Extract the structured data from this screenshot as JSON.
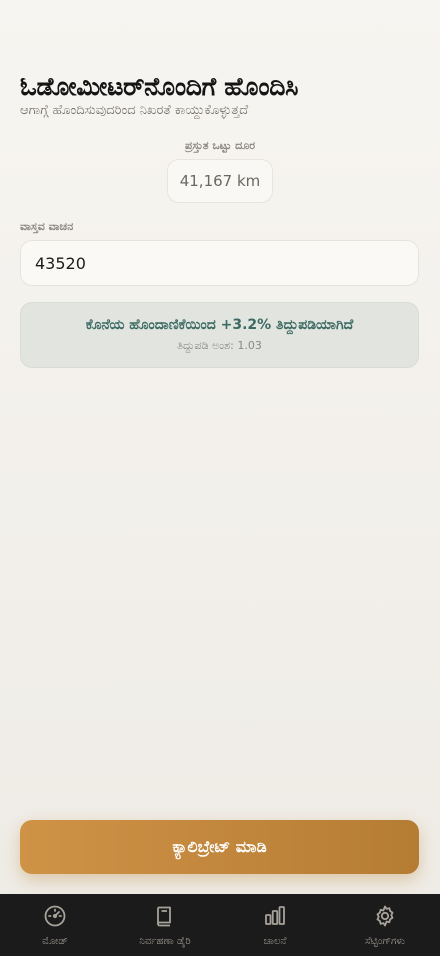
{
  "header": {
    "title": "ಓಡೋಮೀಟರ್‌ನೊಂದಿಗೆ ಹೊಂದಿಸಿ",
    "subtitle": "ಆಗಾಗ್ಗೆ ಹೊಂದಿಸುವುದರಿಂದ ನಿಖರತೆ ಕಾಯ್ದುಕೊಳ್ಳುತ್ತದೆ"
  },
  "odometer": {
    "label": "ಪ್ರಸ್ತುತ ಒಟ್ಟು ದೂರ",
    "value": "41,167 km"
  },
  "reading": {
    "label": "ವಾಸ್ತವ ವಾಚನ",
    "value": "43520"
  },
  "correction": {
    "message": "ಕೊನೆಯ ಹೊಂದಾಣಿಕೆಯಿಂದ +3.2% ತಿದ್ದುಪಡಿಯಾಗಿದೆ",
    "factor_label": "ತಿದ್ದುಪಡಿ ಅಂಶ: 1.03"
  },
  "action": {
    "calibrate_label": "ಕ್ಯಾಲಿಬ್ರೇಟ್ ಮಾಡಿ"
  },
  "tabs": [
    {
      "label": "ಮೋಡ್",
      "icon": "speedometer-icon"
    },
    {
      "label": "ನಿರ್ವಹಣಾ ಡೈರಿ",
      "icon": "book-icon"
    },
    {
      "label": "ಚಾಲನೆ",
      "icon": "bar-chart-icon"
    },
    {
      "label": "ಸೆಟ್ಟಿಂಗ್‌ಗಳು",
      "icon": "gear-icon"
    }
  ],
  "colors": {
    "accent": "#c68a3f",
    "correction_text": "#3d6b63",
    "tabbar_bg": "#1b1b1b"
  }
}
